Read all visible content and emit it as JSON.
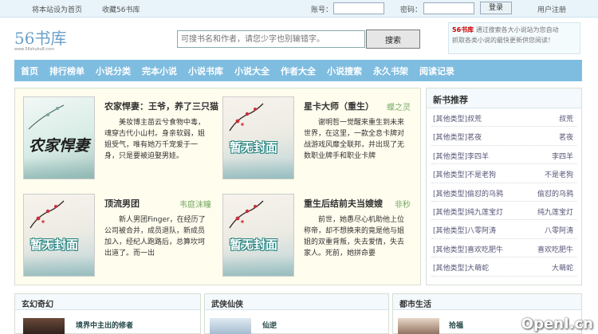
{
  "topbar": {
    "set_home": "将本站设为首页",
    "bookmark": "收藏56书库",
    "account_label": "账号：",
    "password_label": "密码：",
    "login_button": "登录",
    "register": "用户注册"
  },
  "header": {
    "logo": "56书库",
    "logo_url": "www.56shuku8.com",
    "search_placeholder": "可搜书名和作者，请您少字也别输错字。",
    "search_button": "搜索",
    "promo_site": "56书库",
    "promo_text_1": "通过搜索各大小说站为您自动",
    "promo_text_2": "抓取各类小说的最快更新供您阅读！"
  },
  "nav": [
    "首页",
    "排行榜单",
    "小说分类",
    "完本小说",
    "小说书库",
    "小说大全",
    "作者大全",
    "小说搜索",
    "永久书架",
    "阅读记录"
  ],
  "books": [
    {
      "title": "农家悍妻：王爷，养了三只猫",
      "author": "",
      "desc": "美妆博主苗云兮食物中毒，魂穿古代小山村。身亲软弱，姐姐受气，唯有她万千宠爱于一身，只是要被迫娶男娃。",
      "cover_text": "农家悍妻"
    },
    {
      "title": "星卡大师（重生）",
      "author": "蝶之灵",
      "desc": "谢明哲一觉醒来重生到未来世界，在这里，一款全息卡牌对战游戏风靡全联邦，并出现了无数职业牌手和职业卡牌",
      "cover_text": "暂无封面"
    },
    {
      "title": "顶流男团",
      "author": "韦庭沫瞳",
      "desc": "新人男团Finger，在经历了公司被合并，成员退队，新成员加入，经纪人跑路后，总算坎坷出道了。而一出",
      "cover_text": "暂无封面"
    },
    {
      "title": "重生后结前夫当嫂嫂",
      "author": "非秒",
      "desc": "前世，她愚尽心机助他上位称帝，却不想换来的竟是他与姐姐的双重背叛，失去爱情，失去家人。死前，她拼命要",
      "cover_text": "暂无封面"
    }
  ],
  "sidebar": {
    "title": "新书推荐",
    "items": [
      {
        "category": "[其他类型]叔荒",
        "right": "叔荒"
      },
      {
        "category": "[其他类型]茗夜",
        "right": "茗夜"
      },
      {
        "category": "[其他类型]李四羊",
        "right": "李四羊"
      },
      {
        "category": "[其他类型]不是老狗",
        "right": "不是老狗"
      },
      {
        "category": "[其他类型]偷怼的乌鸦",
        "right": "偷怼的乌鸦"
      },
      {
        "category": "[其他类型]纯九莲宝灯",
        "right": "纯九莲宝灯"
      },
      {
        "category": "[其他类型]八零阿涛",
        "right": "八零阿涛"
      },
      {
        "category": "[其他类型]喜欢吃肥牛",
        "right": "喜欢吃肥牛"
      },
      {
        "category": "[其他类型]大萌蛇",
        "right": "大萌蛇"
      }
    ]
  },
  "bottom": {
    "col1_title": "玄幻奇幻",
    "col1_book": "境界中主出的修者",
    "col2_title": "武侠仙侠",
    "col2_book": "仙逆",
    "col3_title": "都市生活",
    "col3_book": "拾福"
  },
  "watermark": "OpenI.cn"
}
